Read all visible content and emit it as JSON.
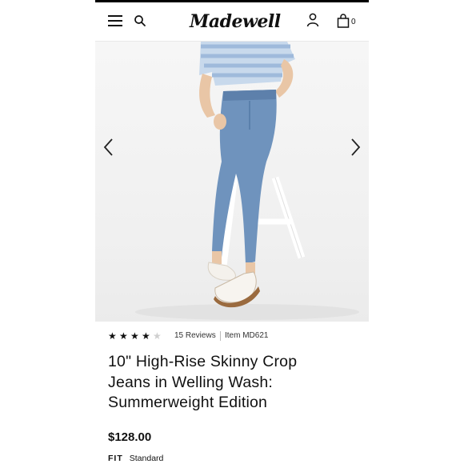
{
  "header": {
    "logo_text": "Madewell",
    "bag_count": "0"
  },
  "product": {
    "rating_stars": 4,
    "rating_max": 5,
    "star_glyph": "★",
    "reviews_label": "15 Reviews",
    "item_number": "Item MD621",
    "title_lines": [
      "10\" High-Rise Skinny Crop",
      "Jeans in Welling Wash:",
      "Summerweight Edition"
    ],
    "price": "$128.00",
    "fit_label": "FIT",
    "fit_value": "Standard"
  },
  "gallery": {
    "prev_icon": "chevron-left-icon",
    "next_icon": "chevron-right-icon"
  },
  "colors": {
    "denim": "#6f93bd",
    "shirt_stripe": "#a9c4e2",
    "text": "#111111"
  }
}
